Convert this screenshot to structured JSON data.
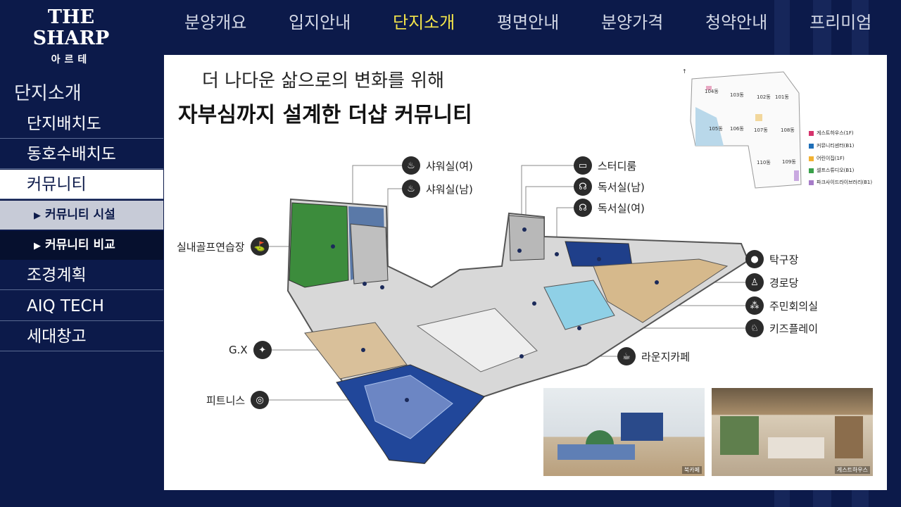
{
  "logo": {
    "main": "THE SHARP",
    "sub": "아르테"
  },
  "nav": [
    {
      "label": "분양개요"
    },
    {
      "label": "입지안내"
    },
    {
      "label": "단지소개",
      "active": true
    },
    {
      "label": "평면안내"
    },
    {
      "label": "분양가격"
    },
    {
      "label": "청약안내"
    },
    {
      "label": "프리미엄"
    }
  ],
  "sidebar": {
    "title": "단지소개",
    "items": [
      {
        "label": "단지배치도"
      },
      {
        "label": "동호수배치도"
      },
      {
        "label": "커뮤니티",
        "active": true
      },
      {
        "label": "커뮤니티 시설",
        "sub": true,
        "active": true
      },
      {
        "label": "커뮤니티 비교",
        "sub": true
      },
      {
        "label": "조경계획"
      },
      {
        "label": "AIQ TECH"
      },
      {
        "label": "세대창고"
      }
    ]
  },
  "main": {
    "subheading": "더 나다운 삶으로의 변화를 위해",
    "heading": "자부심까지 설계한 더샵 커뮤니티"
  },
  "callouts": {
    "shower_f": "샤워실(여)",
    "shower_m": "샤워실(남)",
    "study": "스터디룸",
    "reading_m": "독서실(남)",
    "reading_f": "독서실(여)",
    "golf": "실내골프연습장",
    "tabletennis": "탁구장",
    "senior": "경로당",
    "meeting": "주민회의실",
    "kids": "키즈플레이",
    "gx": "G.X",
    "lounge": "라운지카페",
    "fitness": "피트니스"
  },
  "photos": [
    {
      "caption": "북카페"
    },
    {
      "caption": "게스트하우스"
    }
  ],
  "keymap": {
    "dongs": [
      "104동",
      "103동",
      "102동",
      "101동",
      "105동",
      "106동",
      "107동",
      "108동",
      "110동",
      "109동"
    ],
    "legend": [
      {
        "label": "게스트하우스(1F)",
        "color": "#d6336c"
      },
      {
        "label": "커뮤니티센터(B1)",
        "color": "#1f6fb8"
      },
      {
        "label": "어린이집(1F)",
        "color": "#f2b233"
      },
      {
        "label": "셀프스튜디오(B1)",
        "color": "#3aa14a"
      },
      {
        "label": "파크사이드라이브러리(B1)",
        "color": "#a67cc8"
      }
    ]
  }
}
